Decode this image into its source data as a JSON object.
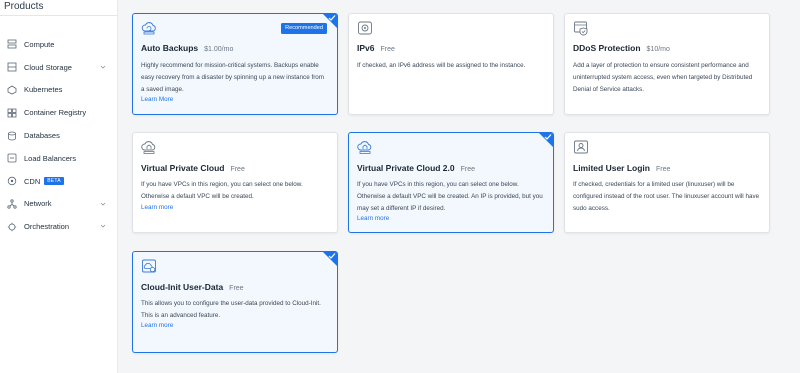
{
  "sidebar": {
    "title": "Products",
    "items": [
      {
        "label": "Compute",
        "icon": "server-icon",
        "chevron": false
      },
      {
        "label": "Cloud Storage",
        "icon": "storage-icon",
        "chevron": true
      },
      {
        "label": "Kubernetes",
        "icon": "kubernetes-icon",
        "chevron": false
      },
      {
        "label": "Container Registry",
        "icon": "registry-icon",
        "chevron": false
      },
      {
        "label": "Databases",
        "icon": "database-icon",
        "chevron": false
      },
      {
        "label": "Load Balancers",
        "icon": "load-balancer-icon",
        "chevron": false
      },
      {
        "label": "CDN",
        "icon": "cdn-icon",
        "chevron": false,
        "badge": "BETA"
      },
      {
        "label": "Network",
        "icon": "network-icon",
        "chevron": true
      },
      {
        "label": "Orchestration",
        "icon": "orchestration-icon",
        "chevron": true
      }
    ]
  },
  "cards": [
    {
      "title": "Auto Backups",
      "price": "$1.00/mo",
      "selected": true,
      "badge": "Recommended",
      "icon": "backup-cloud-icon",
      "desc": "Highly recommend for mission-critical systems. Backups enable easy recovery from a disaster by spinning up a new instance from a saved image.",
      "link": "Learn More"
    },
    {
      "title": "IPv6",
      "price": "Free",
      "selected": false,
      "icon": "ipv6-icon",
      "desc": "If checked, an IPv6 address will be assigned to the instance.",
      "link": ""
    },
    {
      "title": "DDoS Protection",
      "price": "$10/mo",
      "selected": false,
      "icon": "shield-icon",
      "desc": "Add a layer of protection to ensure consistent performance and uninterrupted system access, even when targeted by Distributed Denial of Service attacks.",
      "link": ""
    },
    {
      "title": "Virtual Private Cloud",
      "price": "Free",
      "selected": false,
      "icon": "vpc-cloud-icon",
      "desc": "If you have VPCs in this region, you can select one below. Otherwise a default VPC will be created.",
      "link": "Learn more"
    },
    {
      "title": "Virtual Private Cloud 2.0",
      "price": "Free",
      "selected": true,
      "icon": "vpc-cloud-icon",
      "desc": "If you have VPCs in this region, you can select one below. Otherwise a default VPC will be created. An IP is provided, but you may set a different IP if desired.",
      "link": "Learn more"
    },
    {
      "title": "Limited User Login",
      "price": "Free",
      "selected": false,
      "icon": "user-icon",
      "desc": "If checked, credentials for a limited user (linuxuser) will be configured instead of the root user. The linuxuser account will have sudo access.",
      "link": ""
    },
    {
      "title": "Cloud-Init User-Data",
      "price": "Free",
      "selected": true,
      "icon": "cloud-init-icon",
      "desc": "This allows you to configure the user-data provided to Cloud-Init. This is an advanced feature.",
      "link": "Learn more"
    }
  ],
  "colors": {
    "accent": "#1e73e8",
    "selected_bg": "#f3f8fe"
  }
}
